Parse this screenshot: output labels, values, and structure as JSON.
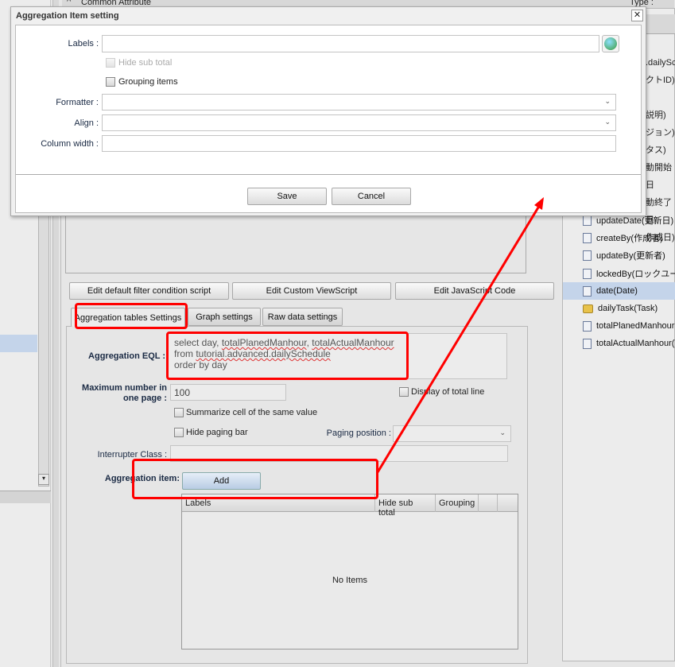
{
  "background": {
    "header_label": "Common Attribute",
    "type_label": "Type :"
  },
  "right_tree": {
    "partial": [
      ".dailySc",
      "クトID)",
      "説明)",
      "ジョン)",
      "タス)",
      "動開始日",
      "動終了日",
      "作成日)"
    ],
    "items": [
      {
        "label": "updateDate(更新日)",
        "icon": "document-icon"
      },
      {
        "label": "createBy(作成者)",
        "icon": "document-icon"
      },
      {
        "label": "updateBy(更新者)",
        "icon": "document-icon"
      },
      {
        "label": "lockedBy(ロックユー",
        "icon": "document-icon"
      },
      {
        "label": "date(Date)",
        "icon": "document-icon",
        "selected": true
      },
      {
        "label": "dailyTask(Task)",
        "icon": "folder-icon"
      },
      {
        "label": "totalPlanedManhour(",
        "icon": "document-icon"
      },
      {
        "label": "totalActualManhour(T",
        "icon": "document-icon"
      }
    ]
  },
  "dialog": {
    "title": "Aggregation Item setting",
    "labels_label": "Labels :",
    "labels_value": "",
    "hide_sub_total": "Hide sub total",
    "grouping_items": "Grouping items",
    "formatter_label": "Formatter :",
    "align_label": "Align :",
    "column_width_label": "Column width :",
    "save": "Save",
    "cancel": "Cancel"
  },
  "main": {
    "buttons": [
      "Edit default filter condition script",
      "Edit Custom ViewScript",
      "Edit JavaScript Code"
    ],
    "tabs": [
      "Aggregation tables Settings",
      "Graph settings",
      "Raw data settings"
    ],
    "eql_label": "Aggregation EQL :",
    "eql_lines": [
      "select day, ",
      "totalPlanedManhour",
      ", ",
      "totalActualManhour",
      "from ",
      "tutorial.advanced.dailySchedule",
      "order by day"
    ],
    "max_label_1": "Maximum number in",
    "max_label_2": "one page :",
    "max_value": "100",
    "display_total_line": "Display of total line",
    "summarize": "Summarize cell of the same value",
    "hide_paging_bar": "Hide paging bar",
    "paging_position_label": "Paging position :",
    "interrupter_label": "Interrupter Class :",
    "agg_item_label": "Aggregation item:",
    "add": "Add",
    "table_headers": [
      "Labels",
      "Hide sub total",
      "Grouping"
    ],
    "empty": "No Items"
  },
  "annotation_color": "#ff0000"
}
